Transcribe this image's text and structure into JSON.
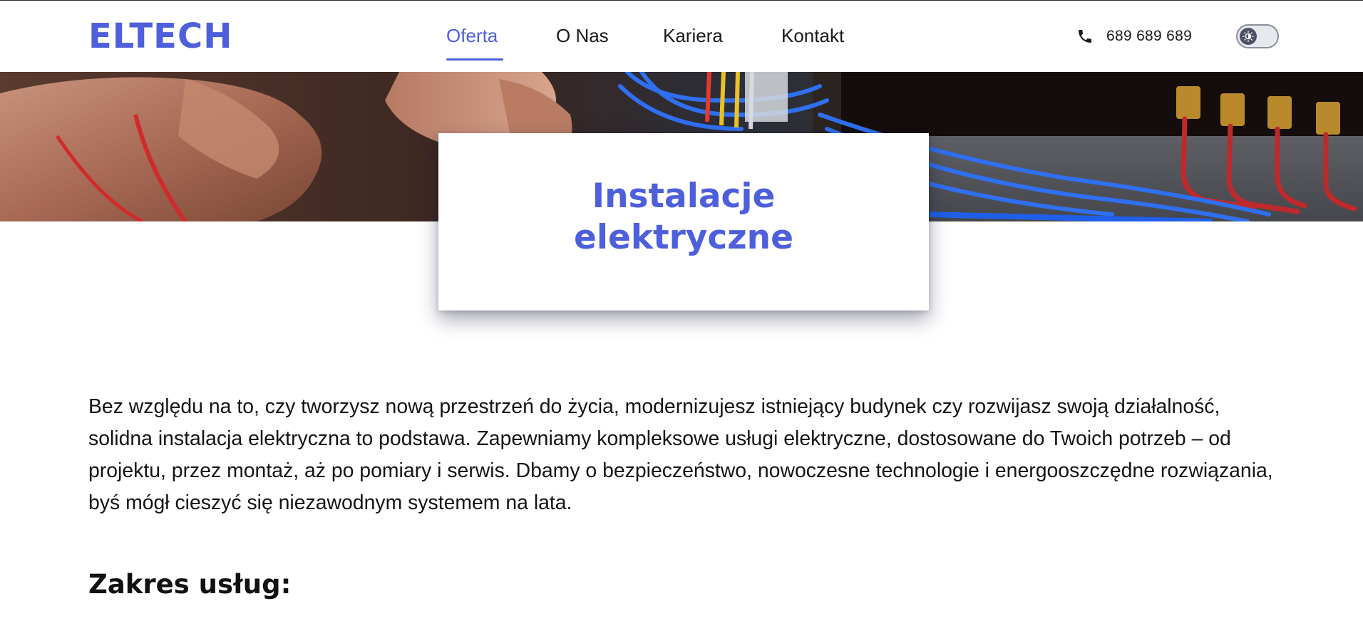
{
  "header": {
    "logo": "ELTECH",
    "nav": [
      {
        "label": "Oferta",
        "active": true
      },
      {
        "label": "O Nas",
        "active": false
      },
      {
        "label": "Kariera",
        "active": false
      },
      {
        "label": "Kontakt",
        "active": false
      }
    ],
    "phone": "689 689 689",
    "phone_icon": "phone-icon",
    "theme_toggle_icon": "brightness-icon"
  },
  "hero": {
    "title": "Instalacje elektryczne"
  },
  "content": {
    "intro": "Bez względu na to, czy tworzysz nową przestrzeń do życia, modernizujesz istniejący budynek czy rozwijasz swoją działalność, solidna instalacja elektryczna to podstawa. Zapewniamy kompleksowe usługi elektryczne, dostosowane do Twoich potrzeb – od projektu, przez montaż, aż po pomiary i serwis. Dbamy o bezpieczeństwo, nowoczesne technologie i energooszczędne rozwiązania, byś mógł cieszyć się niezawodnym systemem na lata.",
    "section_heading": "Zakres usług:"
  },
  "colors": {
    "accent": "#4e5fdc",
    "text": "#141414",
    "background": "#ffffff"
  }
}
